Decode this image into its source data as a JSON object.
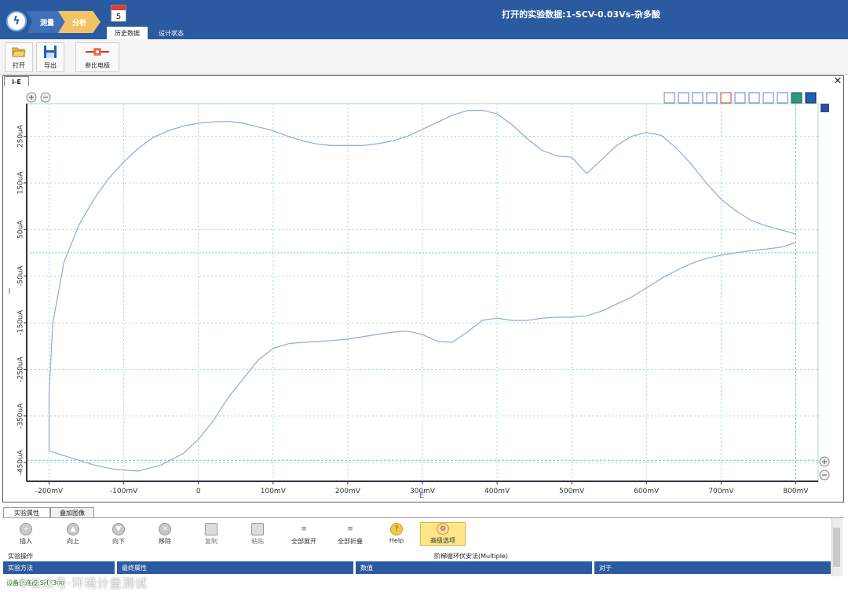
{
  "titlebar": {
    "title": "打开的实验数据:1-SCV-0.03Vs-杂多酸",
    "breadcrumb": [
      "测量",
      "分析"
    ],
    "badge_count": "5",
    "tabs": [
      "历史数据",
      "设计状态"
    ],
    "bg_color": "#2c5aa0"
  },
  "toolbar": {
    "open_label": "打开",
    "export_label": "导出",
    "ref_electrode_label": "参比电极"
  },
  "document": {
    "tab_label": "I-E",
    "close_glyph": "✕"
  },
  "chart_data": {
    "type": "line",
    "xlabel": "E",
    "ylabel": "I",
    "x_ticks": [
      "-200mV",
      "-100mV",
      "0",
      "100mV",
      "200mV",
      "300mV",
      "400mV",
      "500mV",
      "600mV",
      "700mV",
      "800mV"
    ],
    "y_ticks": [
      "250uA",
      "150uA",
      "50uA",
      "-50uA",
      "-150uA",
      "-250uA",
      "-350uA",
      "-450uA"
    ],
    "xlim": [
      -230,
      830
    ],
    "ylim": [
      -490,
      320
    ],
    "grid": true,
    "line_color": "#8fa8de",
    "cursor_color": "#6cc8b8",
    "cursors": {
      "x": 800,
      "y": -445,
      "y0": 0
    },
    "series": [
      {
        "x": [
          800,
          790,
          760,
          740,
          720,
          700,
          680,
          660,
          640,
          620,
          600,
          580,
          560,
          540,
          520,
          500,
          480,
          460,
          440,
          420,
          400,
          380,
          360,
          340,
          320,
          300,
          280,
          260,
          240,
          220,
          200,
          180,
          160,
          140,
          120,
          100,
          80,
          60,
          40,
          20,
          0,
          -20,
          -40,
          -60,
          -80,
          -100,
          -120,
          -140,
          -160,
          -180,
          -195,
          -200,
          -200,
          -170,
          -140,
          -110,
          -80,
          -50,
          -20,
          0,
          20,
          40,
          60,
          80,
          100,
          120,
          140,
          160,
          180,
          200,
          220,
          240,
          260,
          280,
          300,
          320,
          340,
          360,
          380,
          400,
          420,
          440,
          460,
          480,
          500,
          520,
          540,
          560,
          580,
          600,
          620,
          640,
          660,
          680,
          700,
          720,
          740,
          760,
          780,
          800
        ],
        "y": [
          40,
          45,
          58,
          70,
          90,
          115,
          150,
          190,
          225,
          252,
          258,
          250,
          230,
          200,
          170,
          205,
          208,
          220,
          245,
          275,
          298,
          306,
          305,
          295,
          280,
          265,
          250,
          240,
          234,
          230,
          230,
          230,
          233,
          240,
          250,
          262,
          270,
          278,
          282,
          281,
          278,
          272,
          262,
          248,
          225,
          195,
          160,
          115,
          60,
          -20,
          -150,
          -300,
          -425,
          -440,
          -455,
          -465,
          -468,
          -455,
          -430,
          -400,
          -360,
          -310,
          -270,
          -230,
          -205,
          -195,
          -192,
          -190,
          -188,
          -185,
          -180,
          -175,
          -170,
          -168,
          -175,
          -190,
          -192,
          -170,
          -145,
          -140,
          -145,
          -145,
          -140,
          -138,
          -138,
          -135,
          -125,
          -110,
          -95,
          -75,
          -55,
          -38,
          -23,
          -12,
          -5,
          0,
          5,
          8,
          12,
          22
        ]
      }
    ]
  },
  "bottom_tabs": [
    "实验属性",
    "叠加图像"
  ],
  "panel": {
    "buttons": [
      "插入",
      "向上",
      "向下",
      "移除",
      "复制",
      "粘贴",
      "全部展开",
      "全部折叠",
      "Help",
      "高级选项"
    ],
    "experiment_label": "实验操作",
    "method_label": "阶梯循环伏安法(Multiple)",
    "columns": [
      "实验方法",
      "最终属性",
      "数值",
      "对于"
    ]
  },
  "status": "设备已连接:SH7300",
  "watermark": "©公众号·环境计量测试"
}
